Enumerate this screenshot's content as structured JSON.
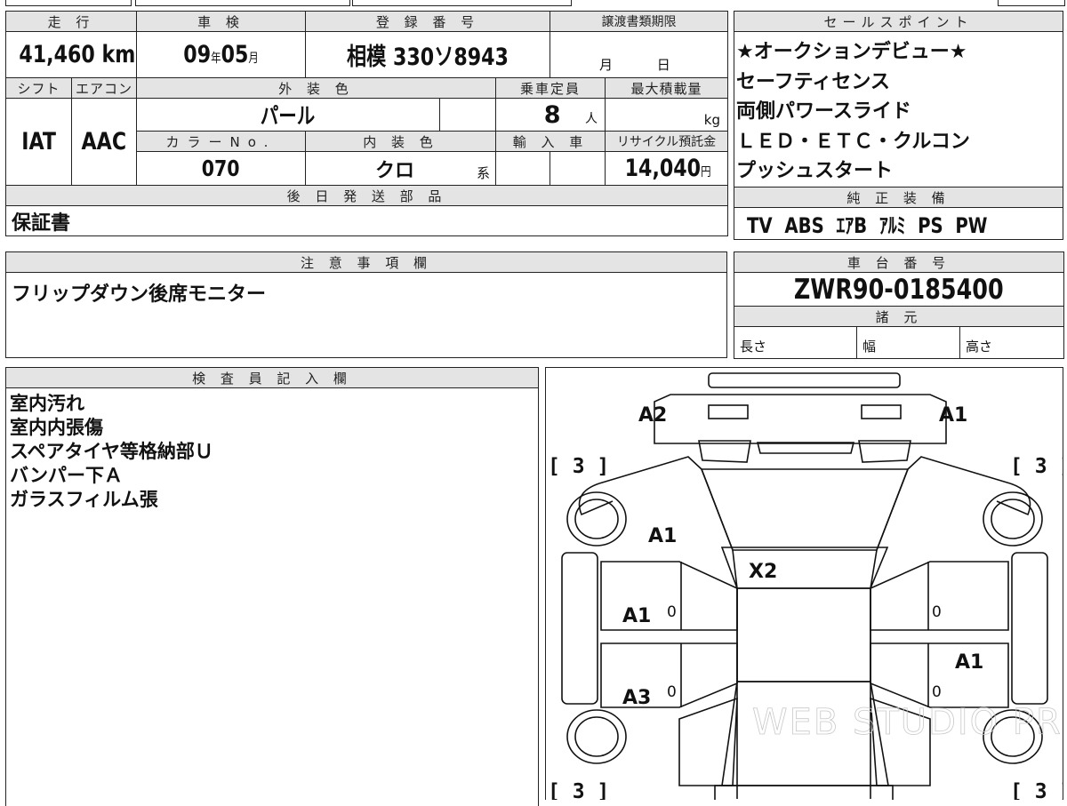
{
  "vehicle": {
    "mileage_label": "走 行",
    "mileage_value": "41,460",
    "mileage_unit": "km",
    "inspection_label": "車 検",
    "inspection_year": "09",
    "inspection_year_unit": "年",
    "inspection_month": "05",
    "inspection_month_unit": "月",
    "registration_label": "登 録 番 号",
    "registration_value": "相模 330ソ8943",
    "transfer_deadline_label": "譲渡書類期限",
    "transfer_month_unit": "月",
    "transfer_day_unit": "日",
    "shift_label": "シフト",
    "shift_value": "IAT",
    "aircon_label": "エアコン",
    "aircon_value": "AAC",
    "exterior_color_label": "外 装 色",
    "exterior_color_value": "パール",
    "capacity_label": "乗車定員",
    "capacity_value": "8",
    "capacity_unit": "人",
    "max_load_label": "最大積載量",
    "max_load_unit": "kg",
    "color_no_label": "カラーNo.",
    "color_no_value": "070",
    "interior_color_label": "内 装 色",
    "interior_color_value": "クロ",
    "interior_color_suffix": "系",
    "import_label": "輸 入 車",
    "recycle_label": "リサイクル預託金",
    "recycle_value": "14,040",
    "recycle_unit": "円"
  },
  "sales_points": {
    "label": "セールスポイント",
    "lines": [
      "★オークションデビュー★",
      "セーフティセンス",
      "両側パワースライド",
      "ＬＥＤ・ＥＴＣ・クルコン",
      "プッシュスタート"
    ]
  },
  "later_shipment": {
    "label": "後 日 発 送 部 品",
    "value": "保証書"
  },
  "genuine_equipment": {
    "label": "純 正 装 備",
    "value": "TV  ABS  ｴｱB  ｱﾙﾐ  PS  PW"
  },
  "notes": {
    "label": "注 意 事 項 欄",
    "value": "フリップダウン後席モニター"
  },
  "chassis": {
    "label": "車 台 番 号",
    "value": "ZWR90-0185400"
  },
  "specs": {
    "label": "諸 元",
    "length_label": "長さ",
    "width_label": "幅",
    "height_label": "高さ"
  },
  "inspector": {
    "label": "検 査 員 記 入 欄",
    "lines": [
      "室内汚れ",
      "室内内張傷",
      "スペアタイヤ等格納部Ｕ",
      "バンパー下Ａ",
      "ガラスフィルム張"
    ]
  },
  "diagram": {
    "codes": {
      "front_left": "A2",
      "front_right": "A1",
      "left_fender": "A1",
      "hood": "X2",
      "left_front_door": "A1",
      "left_rear_door": "A3",
      "right_rear_door": "A1"
    },
    "tire_brackets": [
      "[ 3 ]",
      "[ 3 ]",
      "[ 3 ]",
      "[ 3 ]"
    ],
    "zeros": [
      "0",
      "0",
      "0",
      "0"
    ],
    "watermark": "WEB STUDIO PRO"
  }
}
